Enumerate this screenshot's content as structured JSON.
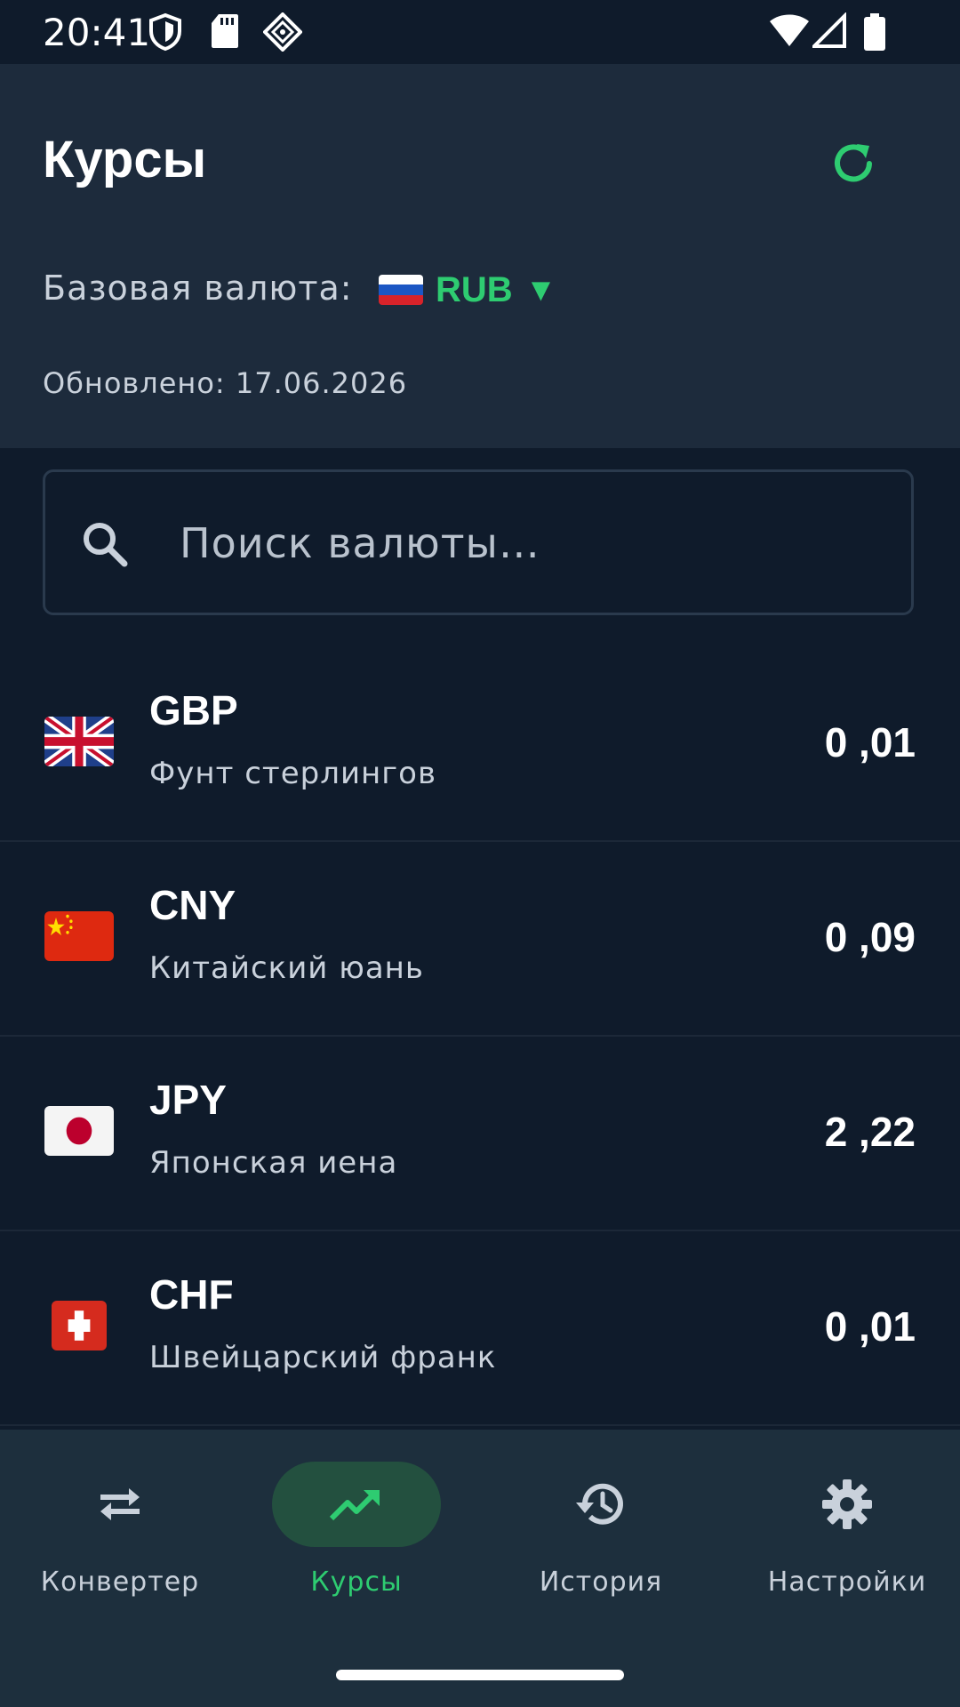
{
  "status_bar": {
    "time": "20:41",
    "icons": [
      "shield-icon",
      "sd-card-icon",
      "vpn-diamond-icon",
      "wifi-icon",
      "signal-icon",
      "battery-icon"
    ]
  },
  "header": {
    "title": "Курсы",
    "refresh_icon": "refresh-icon",
    "base_label": "Базовая валюта:",
    "base_currency": "RUB",
    "base_caret": "▼",
    "updated": "Обновлено: 17.06.2026"
  },
  "search": {
    "placeholder": "Поиск валюты…",
    "value": ""
  },
  "rates": [
    {
      "code": "GBP",
      "name": "Фунт стерлингов",
      "value": "0 ,01",
      "flag": "uk-flag"
    },
    {
      "code": "CNY",
      "name": "Китайский юань",
      "value": "0 ,09",
      "flag": "cn-flag"
    },
    {
      "code": "JPY",
      "name": "Японская иена",
      "value": "2 ,22",
      "flag": "jp-flag"
    },
    {
      "code": "CHF",
      "name": "Швейцарский франк",
      "value": "0 ,01",
      "flag": "ch-flag"
    }
  ],
  "nav": [
    {
      "label": "Конвертер",
      "icon": "swap-icon",
      "active": false
    },
    {
      "label": "Курсы",
      "icon": "trending-up-icon",
      "active": true
    },
    {
      "label": "История",
      "icon": "history-icon",
      "active": false
    },
    {
      "label": "Настройки",
      "icon": "gear-icon",
      "active": false
    }
  ],
  "colors": {
    "accent": "#2ecc71",
    "background": "#0f1b2b",
    "header_bg": "#1d2b3c",
    "nav_bg": "#1d2f3d"
  }
}
